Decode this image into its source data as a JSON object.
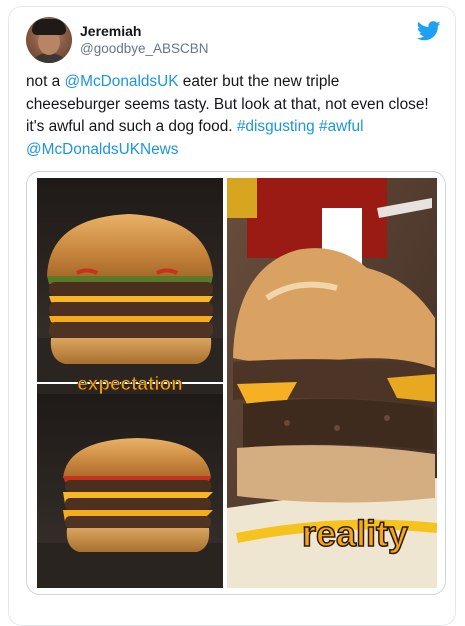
{
  "tweet": {
    "author_name": "Jeremiah",
    "author_handle": "@goodbye_ABSCBN",
    "text_parts": {
      "p1": "not a ",
      "mention1": "@McDonaldsUK",
      "p2": " eater but the new triple cheeseburger seems tasty. But look at that, not even close! it's awful and such a dog food. ",
      "hashtag1": "#disgusting",
      "sp1": " ",
      "hashtag2": "#awful",
      "sp2": " ",
      "mention2": "@McDonaldsUKNews"
    }
  },
  "media": {
    "expectation_label": "expectation",
    "reality_label": "reality"
  },
  "colors": {
    "link": "#1b95e0",
    "twitter_blue": "#1da1f2",
    "label_fill": "#f7a41d",
    "border": "#e1e8ed"
  },
  "icons": {
    "bird": "twitter-bird-icon"
  }
}
